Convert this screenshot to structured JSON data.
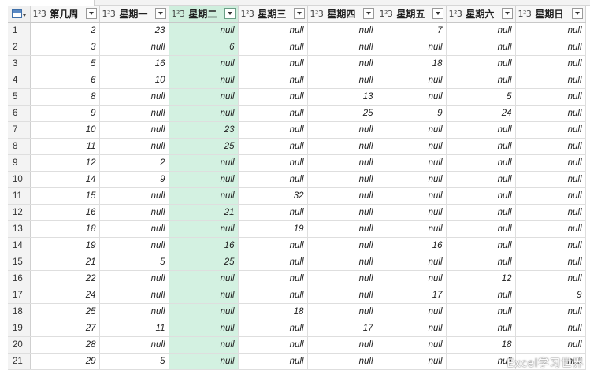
{
  "columns": [
    {
      "name": "第几周",
      "type_icon": "1²3"
    },
    {
      "name": "星期一",
      "type_icon": "1²3"
    },
    {
      "name": "星期二",
      "type_icon": "1²3"
    },
    {
      "name": "星期三",
      "type_icon": "1²3"
    },
    {
      "name": "星期四",
      "type_icon": "1²3"
    },
    {
      "name": "星期五",
      "type_icon": "1²3"
    },
    {
      "name": "星期六",
      "type_icon": "1²3"
    },
    {
      "name": "星期日",
      "type_icon": "1²3"
    }
  ],
  "selected_column": "星期二",
  "selected_color": "#d3f1e1",
  "corner_icon": "table-icon",
  "rows": [
    [
      "1",
      "2",
      "23",
      "null",
      "null",
      "null",
      "7",
      "null",
      "null"
    ],
    [
      "2",
      "3",
      "null",
      "6",
      "null",
      "null",
      "null",
      "null",
      "null"
    ],
    [
      "3",
      "5",
      "16",
      "null",
      "null",
      "null",
      "18",
      "null",
      "null"
    ],
    [
      "4",
      "6",
      "10",
      "null",
      "null",
      "null",
      "null",
      "null",
      "null"
    ],
    [
      "5",
      "8",
      "null",
      "null",
      "null",
      "13",
      "null",
      "5",
      "null"
    ],
    [
      "6",
      "9",
      "null",
      "null",
      "null",
      "25",
      "9",
      "24",
      "null"
    ],
    [
      "7",
      "10",
      "null",
      "23",
      "null",
      "null",
      "null",
      "null",
      "null"
    ],
    [
      "8",
      "11",
      "null",
      "25",
      "null",
      "null",
      "null",
      "null",
      "null"
    ],
    [
      "9",
      "12",
      "2",
      "null",
      "null",
      "null",
      "null",
      "null",
      "null"
    ],
    [
      "10",
      "14",
      "9",
      "null",
      "null",
      "null",
      "null",
      "null",
      "null"
    ],
    [
      "11",
      "15",
      "null",
      "null",
      "32",
      "null",
      "null",
      "null",
      "null"
    ],
    [
      "12",
      "16",
      "null",
      "21",
      "null",
      "null",
      "null",
      "null",
      "null"
    ],
    [
      "13",
      "18",
      "null",
      "null",
      "19",
      "null",
      "null",
      "null",
      "null"
    ],
    [
      "14",
      "19",
      "null",
      "16",
      "null",
      "null",
      "16",
      "null",
      "null"
    ],
    [
      "15",
      "21",
      "5",
      "25",
      "null",
      "null",
      "null",
      "null",
      "null"
    ],
    [
      "16",
      "22",
      "null",
      "null",
      "null",
      "null",
      "null",
      "12",
      "null"
    ],
    [
      "17",
      "24",
      "null",
      "null",
      "null",
      "null",
      "17",
      "null",
      "9"
    ],
    [
      "18",
      "25",
      "null",
      "null",
      "18",
      "null",
      "null",
      "null",
      "null"
    ],
    [
      "19",
      "27",
      "11",
      "null",
      "null",
      "17",
      "null",
      "null",
      "null"
    ],
    [
      "20",
      "28",
      "null",
      "null",
      "null",
      "null",
      "null",
      "18",
      "null"
    ],
    [
      "21",
      "29",
      "5",
      "null",
      "null",
      "null",
      "null",
      "null",
      "null"
    ]
  ],
  "watermark": "Excel学习世界"
}
